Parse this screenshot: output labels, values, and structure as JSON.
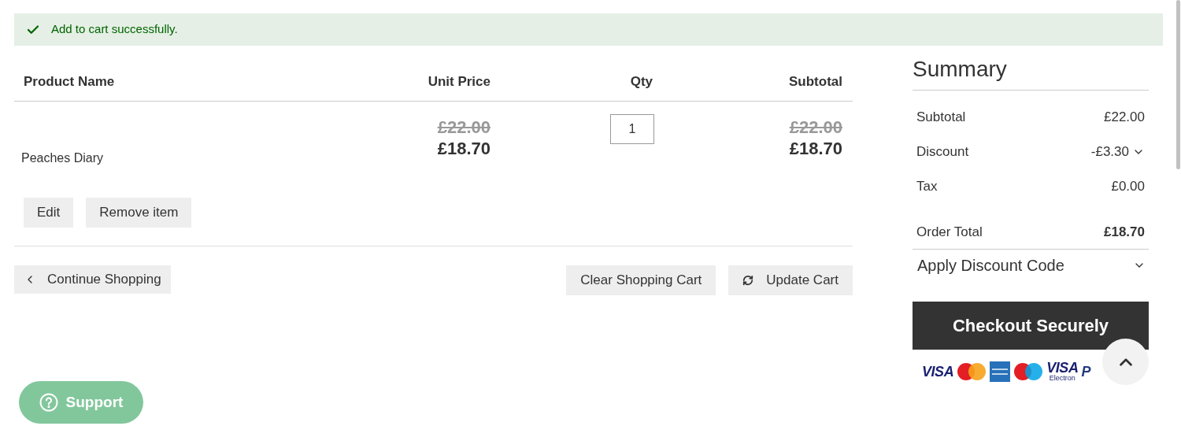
{
  "message": {
    "text": "Add to cart successfully."
  },
  "table": {
    "columns": [
      "Product Name",
      "Unit Price",
      "Qty",
      "Subtotal"
    ],
    "rows": [
      {
        "name": "Peaches Diary",
        "old_price": "£22.00",
        "price": "£18.70",
        "qty": "1",
        "old_subtotal": "£22.00",
        "subtotal": "£18.70"
      }
    ]
  },
  "item_actions": [
    "Edit",
    "Remove item"
  ],
  "cart_actions": {
    "continue": "Continue Shopping",
    "clear": "Clear Shopping Cart",
    "update": "Update Cart"
  },
  "summary": {
    "title": "Summary",
    "lines": [
      {
        "label": "Subtotal",
        "value": "£22.00",
        "kind": "plain"
      },
      {
        "label": "Discount",
        "value": "-£3.30",
        "kind": "expandable"
      },
      {
        "label": "Tax",
        "value": "£0.00",
        "kind": "plain"
      },
      {
        "label": "Order Total",
        "value": "£18.70",
        "kind": "total"
      }
    ],
    "discount_code": {
      "label": "Apply Discount Code",
      "expanded": false
    },
    "checkout": "Checkout Securely",
    "payment_logos": [
      {
        "kind": "visa",
        "label": "VISA"
      },
      {
        "kind": "mastercard"
      },
      {
        "kind": "amex"
      },
      {
        "kind": "maestro"
      },
      {
        "kind": "visa",
        "label": "VISA",
        "sublabel": "Electron"
      },
      {
        "kind": "paypal",
        "label": "P"
      }
    ]
  },
  "support": {
    "label": "Support"
  }
}
